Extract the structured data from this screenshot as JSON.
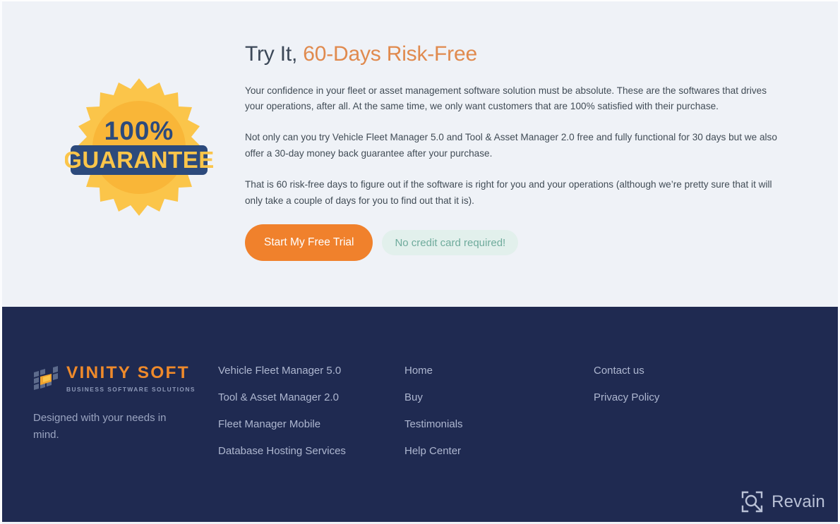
{
  "colors": {
    "page_bg": "#eff2f7",
    "footer_bg": "#1f2a51",
    "accent_orange": "#e08a4e",
    "button_orange": "#f0812c",
    "pill_bg": "#e2f0ec",
    "pill_text": "#6fab9c",
    "body_text": "#414c56",
    "heading_text": "#3c4858",
    "footer_link": "#aeb7d0",
    "logo_orange": "#ef8a2b",
    "badge_yellow": "#fbc54a",
    "badge_blue": "#2c4a7c"
  },
  "hero": {
    "title_lead": "Try It,",
    "title_accent": "60-Days Risk-Free",
    "paragraphs": [
      "Your confidence in your fleet or asset management software solution must be absolute. These are the softwares that drives your operations, after all. At the same time, we only want customers that are 100% satisfied with their purchase.",
      "Not only can you try Vehicle Fleet Manager 5.0 and Tool & Asset Manager 2.0 free and fully functional for 30 days but we also offer a 30-day money back guarantee after your purchase.",
      "That is 60 risk-free days to figure out if the software is right for you and your operations (although we’re pretty sure that it will only take a couple of days for you to find out that it is)."
    ],
    "cta_button": "Start My Free Trial",
    "no_card_pill": "No credit card required!",
    "badge": {
      "icon": "guarantee-seal-icon",
      "percent_text": "100%",
      "banner_text": "GUARANTEE"
    }
  },
  "footer": {
    "brand": {
      "logo_icon": "vinity-soft-tiles-icon",
      "name": "VINITY SOFT",
      "tagline": "BUSINESS SOFTWARE SOLUTIONS",
      "note": "Designed with your needs in mind."
    },
    "columns": [
      {
        "links": [
          "Vehicle Fleet Manager 5.0",
          "Tool & Asset Manager 2.0",
          "Fleet Manager Mobile",
          "Database Hosting Services"
        ]
      },
      {
        "links": [
          "Home",
          "Buy",
          "Testimonials",
          "Help Center"
        ]
      },
      {
        "links": [
          "Contact us",
          "Privacy Policy"
        ]
      }
    ]
  },
  "watermark": {
    "icon": "revain-logo-icon",
    "label": "Revain"
  }
}
